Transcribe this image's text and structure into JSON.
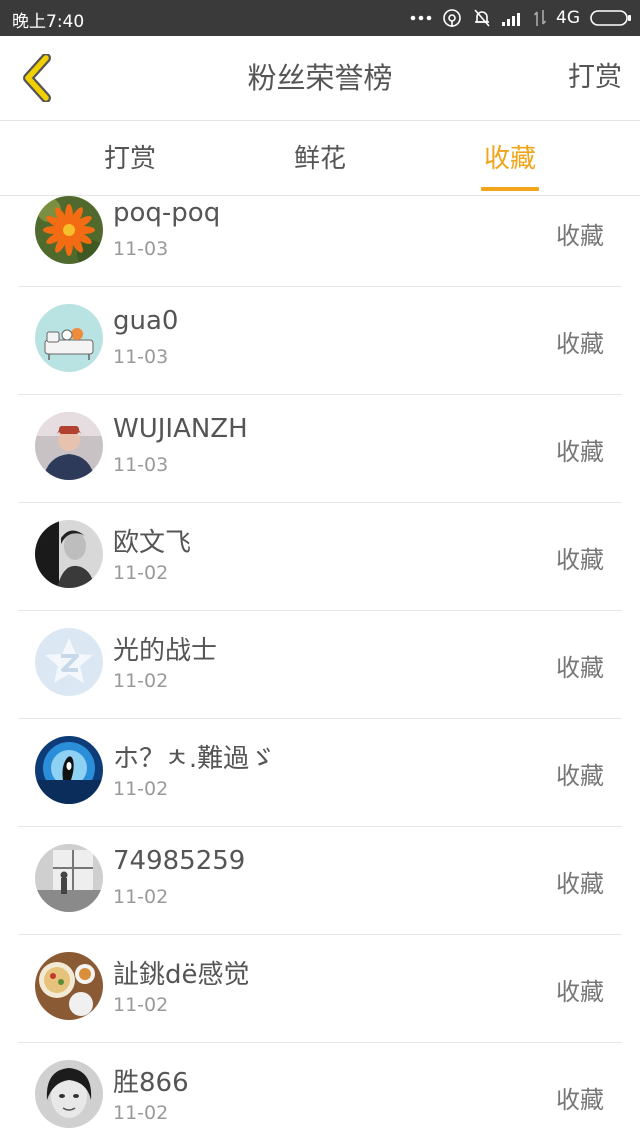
{
  "status_bar": {
    "time": "晚上7:40",
    "network": "4G"
  },
  "header": {
    "title": "粉丝荣誉榜",
    "right_action": "打赏"
  },
  "tabs": [
    {
      "label": "打赏",
      "active": false
    },
    {
      "label": "鲜花",
      "active": false
    },
    {
      "label": "收藏",
      "active": true
    }
  ],
  "colors": {
    "accent": "#f0a51a",
    "back_icon": "#f2d000",
    "status_bar_bg": "#3a3a3a"
  },
  "list": [
    {
      "name": "poq-poq",
      "date": "11-03",
      "action": "收藏",
      "avatar": "orange-flower-avatar"
    },
    {
      "name": "gua0",
      "date": "11-03",
      "action": "收藏",
      "avatar": "cartoon-sofa-avatar"
    },
    {
      "name": "WUJIANZH",
      "date": "11-03",
      "action": "收藏",
      "avatar": "person-photo-avatar"
    },
    {
      "name": "欧文飞",
      "date": "11-02",
      "action": "收藏",
      "avatar": "bw-portrait-avatar"
    },
    {
      "name": "光的战士",
      "date": "11-02",
      "action": "收藏",
      "avatar": "default-qzone-avatar"
    },
    {
      "name": "ホ？ㅊ.難過ゞ",
      "date": "11-02",
      "action": "收藏",
      "avatar": "orca-avatar"
    },
    {
      "name": "74985259",
      "date": "11-02",
      "action": "收藏",
      "avatar": "window-photo-avatar"
    },
    {
      "name": "訨銚dë感觉",
      "date": "11-02",
      "action": "收藏",
      "avatar": "food-avatar"
    },
    {
      "name": "胜866",
      "date": "11-02",
      "action": "收藏",
      "avatar": "bw-girl-avatar"
    }
  ]
}
